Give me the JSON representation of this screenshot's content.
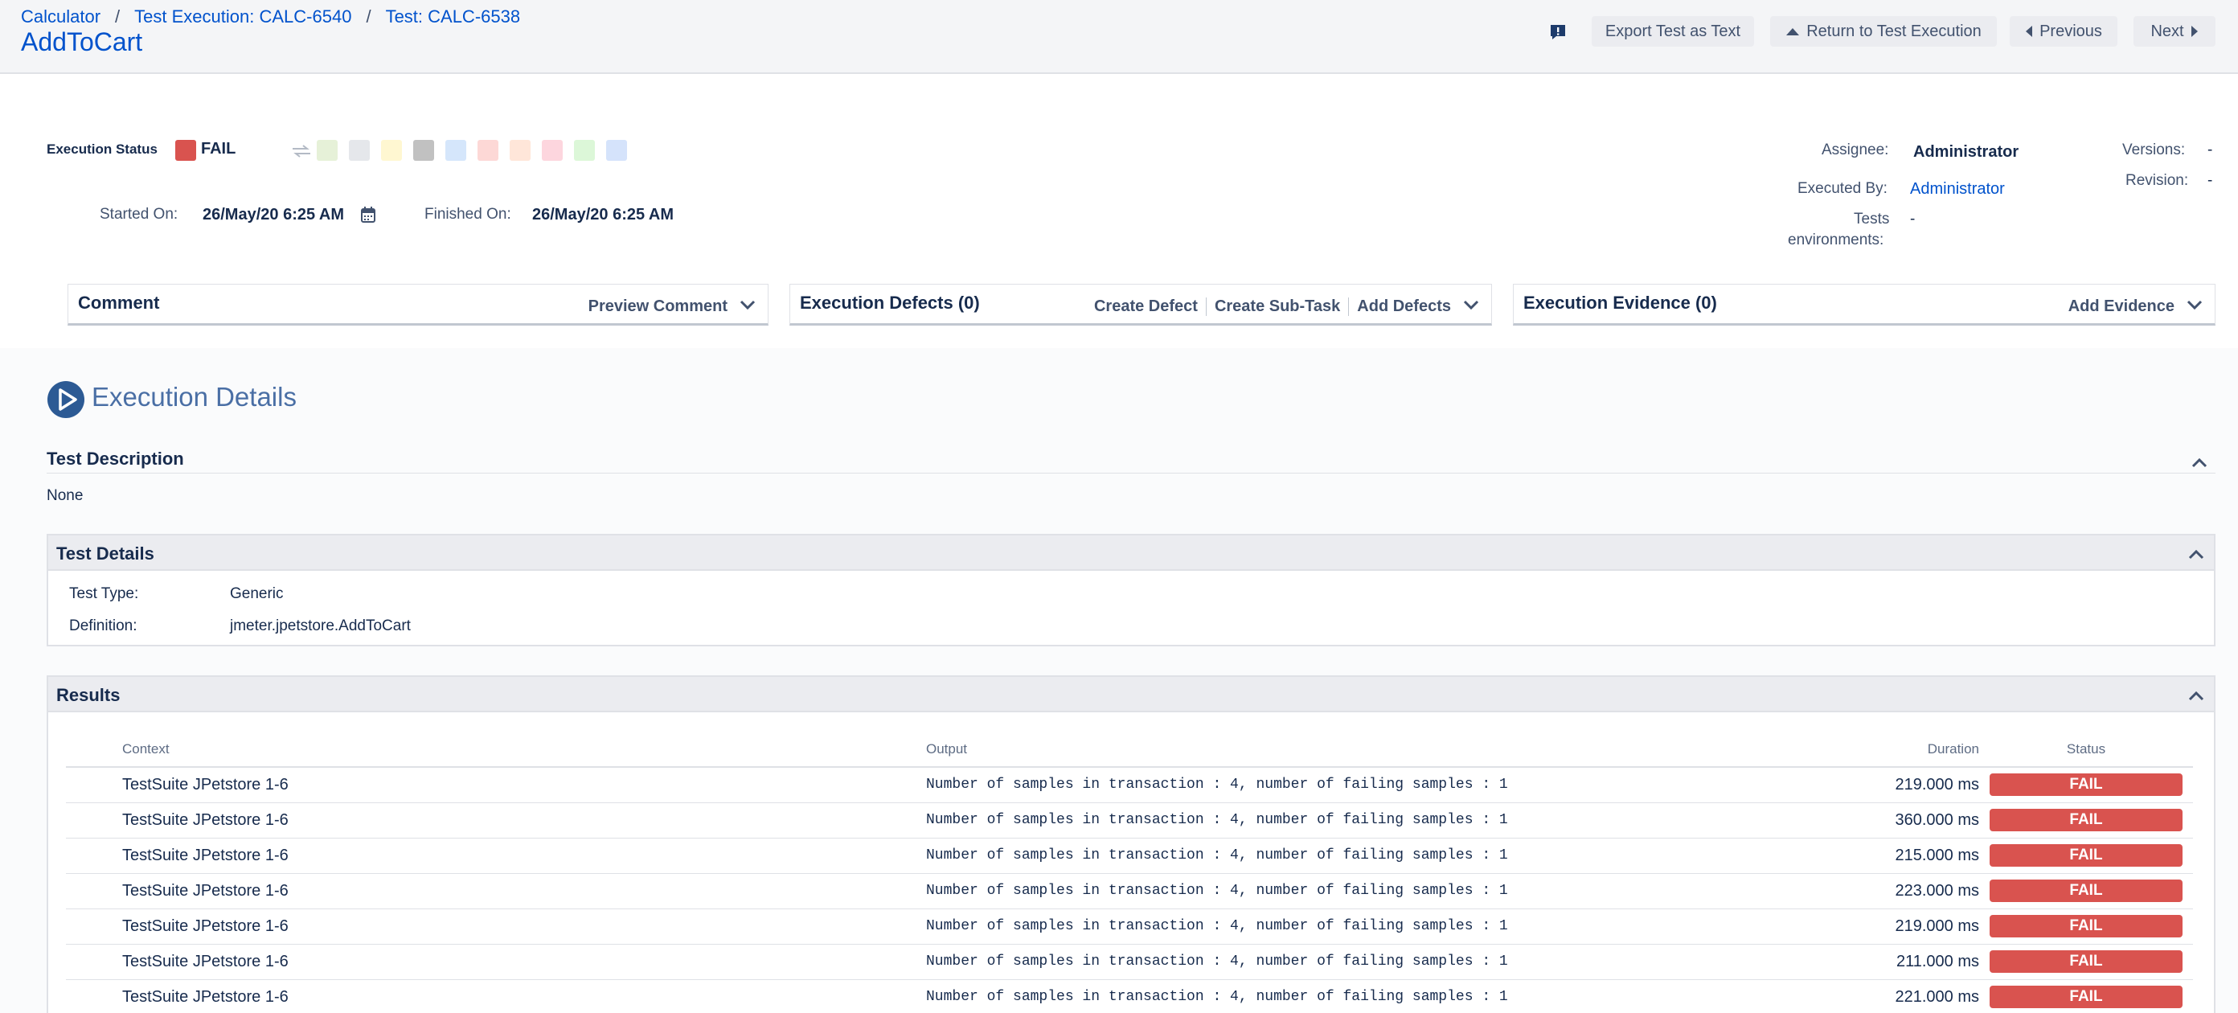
{
  "breadcrumb": {
    "items": [
      "Calculator",
      "Test Execution: CALC-6540",
      "Test: CALC-6538"
    ],
    "separator": "/"
  },
  "page_title": "AddToCart",
  "header_buttons": {
    "export": "Export Test as Text",
    "return": "Return to Test Execution",
    "previous": "Previous",
    "next": "Next"
  },
  "execution": {
    "status_label": "Execution Status",
    "status_value": "FAIL",
    "status_color": "#d9534f",
    "status_options_colors": [
      "#e6f1d8",
      "#e5e7eb",
      "#fff7d1",
      "#c1c1c1",
      "#d5e6fb",
      "#fdd8d6",
      "#ffe6d9",
      "#fdd6de",
      "#dcf7d8",
      "#d5e3fb"
    ],
    "started_label": "Started On:",
    "started_value": "26/May/20 6:25 AM",
    "finished_label": "Finished On:",
    "finished_value": "26/May/20 6:25 AM"
  },
  "people": {
    "assignee_label": "Assignee:",
    "assignee_value": "Administrator",
    "executed_by_label": "Executed By:",
    "executed_by_value": "Administrator",
    "envs_label_1": "Tests",
    "envs_label_2": "environments:",
    "envs_value": "-",
    "versions_label": "Versions:",
    "versions_value": "-",
    "revision_label": "Revision:",
    "revision_value": "-"
  },
  "panels": {
    "comment": {
      "title": "Comment",
      "action": "Preview Comment"
    },
    "defects": {
      "title": "Execution Defects (0)",
      "actions": [
        "Create Defect",
        "Create Sub-Task",
        "Add Defects"
      ]
    },
    "evidence": {
      "title": "Execution Evidence (0)",
      "action": "Add Evidence"
    }
  },
  "details": {
    "title": "Execution Details",
    "description_heading": "Test Description",
    "description_value": "None",
    "test_details_heading": "Test Details",
    "test_type_label": "Test Type:",
    "test_type_value": "Generic",
    "definition_label": "Definition:",
    "definition_value": "jmeter.jpetstore.AddToCart",
    "results_heading": "Results"
  },
  "results": {
    "columns": [
      "Context",
      "Output",
      "Duration",
      "Status"
    ],
    "rows": [
      {
        "context": "TestSuite JPetstore 1-6",
        "output": "Number of samples in transaction : 4, number of failing samples : 1",
        "duration": "219.000 ms",
        "status": "FAIL"
      },
      {
        "context": "TestSuite JPetstore 1-6",
        "output": "Number of samples in transaction : 4, number of failing samples : 1",
        "duration": "360.000 ms",
        "status": "FAIL"
      },
      {
        "context": "TestSuite JPetstore 1-6",
        "output": "Number of samples in transaction : 4, number of failing samples : 1",
        "duration": "215.000 ms",
        "status": "FAIL"
      },
      {
        "context": "TestSuite JPetstore 1-6",
        "output": "Number of samples in transaction : 4, number of failing samples : 1",
        "duration": "223.000 ms",
        "status": "FAIL"
      },
      {
        "context": "TestSuite JPetstore 1-6",
        "output": "Number of samples in transaction : 4, number of failing samples : 1",
        "duration": "219.000 ms",
        "status": "FAIL"
      },
      {
        "context": "TestSuite JPetstore 1-6",
        "output": "Number of samples in transaction : 4, number of failing samples : 1",
        "duration": "211.000 ms",
        "status": "FAIL"
      },
      {
        "context": "TestSuite JPetstore 1-6",
        "output": "Number of samples in transaction : 4, number of failing samples : 1",
        "duration": "221.000 ms",
        "status": "FAIL"
      }
    ]
  }
}
